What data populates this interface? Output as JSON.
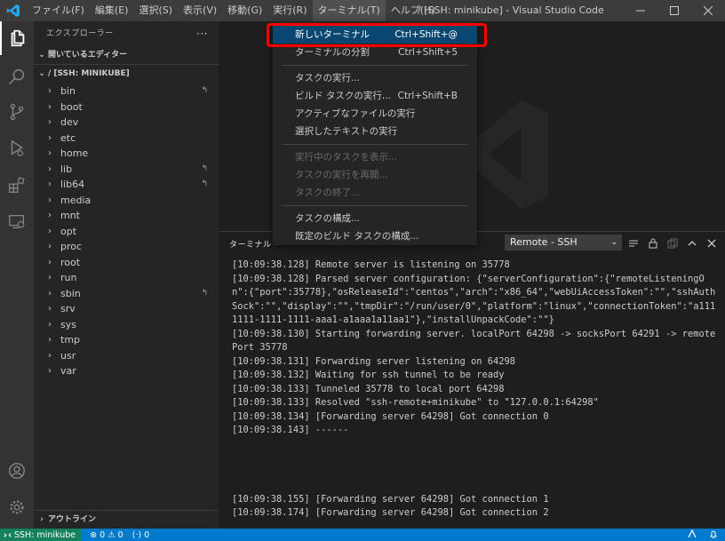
{
  "titlebar": {
    "menus": [
      "ファイル(F)",
      "編集(E)",
      "選択(S)",
      "表示(V)",
      "移動(G)",
      "実行(R)",
      "ターミナル(T)",
      "ヘルプ(H)"
    ],
    "window_title": "/ [SSH: minikube] - Visual Studio Code"
  },
  "sidebar": {
    "title": "エクスプローラー",
    "open_editors": "開いているエディター",
    "root": "/ [SSH: MINIKUBE]",
    "folders": [
      {
        "name": "bin",
        "link": true
      },
      {
        "name": "boot",
        "link": false
      },
      {
        "name": "dev",
        "link": false
      },
      {
        "name": "etc",
        "link": false
      },
      {
        "name": "home",
        "link": false
      },
      {
        "name": "lib",
        "link": true
      },
      {
        "name": "lib64",
        "link": true
      },
      {
        "name": "media",
        "link": false
      },
      {
        "name": "mnt",
        "link": false
      },
      {
        "name": "opt",
        "link": false
      },
      {
        "name": "proc",
        "link": false
      },
      {
        "name": "root",
        "link": false
      },
      {
        "name": "run",
        "link": false
      },
      {
        "name": "sbin",
        "link": true
      },
      {
        "name": "srv",
        "link": false
      },
      {
        "name": "sys",
        "link": false
      },
      {
        "name": "tmp",
        "link": false
      },
      {
        "name": "usr",
        "link": false
      },
      {
        "name": "var",
        "link": false
      }
    ],
    "outline": "アウトライン"
  },
  "terminal_menu": {
    "items": [
      {
        "label": "新しいターミナル",
        "shortcut": "Ctrl+Shift+@",
        "selected": true,
        "disabled": false
      },
      {
        "label": "ターミナルの分割",
        "shortcut": "Ctrl+Shift+5",
        "selected": false,
        "disabled": false
      },
      {
        "sep": true
      },
      {
        "label": "タスクの実行...",
        "shortcut": "",
        "selected": false,
        "disabled": false
      },
      {
        "label": "ビルド タスクの実行...",
        "shortcut": "Ctrl+Shift+B",
        "selected": false,
        "disabled": false
      },
      {
        "label": "アクティブなファイルの実行",
        "shortcut": "",
        "selected": false,
        "disabled": false
      },
      {
        "label": "選択したテキストの実行",
        "shortcut": "",
        "selected": false,
        "disabled": false
      },
      {
        "sep": true
      },
      {
        "label": "実行中のタスクを表示...",
        "shortcut": "",
        "selected": false,
        "disabled": true
      },
      {
        "label": "タスクの実行を再開...",
        "shortcut": "",
        "selected": false,
        "disabled": true
      },
      {
        "label": "タスクの終了...",
        "shortcut": "",
        "selected": false,
        "disabled": true
      },
      {
        "sep": true
      },
      {
        "label": "タスクの構成...",
        "shortcut": "",
        "selected": false,
        "disabled": false
      },
      {
        "label": "既定のビルド タスクの構成...",
        "shortcut": "",
        "selected": false,
        "disabled": false
      }
    ]
  },
  "panel": {
    "tab": "ターミナル",
    "terminal_select": "Remote - SSH",
    "lines": [
      "[10:09:38.128] Remote server is listening on 35778",
      "[10:09:38.128] Parsed server configuration: {\"serverConfiguration\":{\"remoteListeningOn\":{\"port\":35778},\"osReleaseId\":\"centos\",\"arch\":\"x86_64\",\"webUiAccessToken\":\"\",\"sshAuthSock\":\"\",\"display\":\"\",\"tmpDir\":\"/run/user/0\",\"platform\":\"linux\",\"connectionToken\":\"a1111111-1111-1111-aaa1-a1aaa1a11aa1\"},\"installUnpackCode\":\"\"}",
      "[10:09:38.130] Starting forwarding server. localPort 64298 -> socksPort 64291 -> remotePort 35778",
      "[10:09:38.131] Forwarding server listening on 64298",
      "[10:09:38.132] Waiting for ssh tunnel to be ready",
      "[10:09:38.133] Tunneled 35778 to local port 64298",
      "[10:09:38.133] Resolved \"ssh-remote+minikube\" to \"127.0.0.1:64298\"",
      "[10:09:38.134] [Forwarding server 64298] Got connection 0",
      "[10:09:38.143] ------",
      "",
      "",
      "",
      "",
      "[10:09:38.155] [Forwarding server 64298] Got connection 1",
      "[10:09:38.174] [Forwarding server 64298] Got connection 2"
    ]
  },
  "statusbar": {
    "remote": "SSH: minikube",
    "errors": "0",
    "warnings": "0",
    "ports": "0"
  }
}
